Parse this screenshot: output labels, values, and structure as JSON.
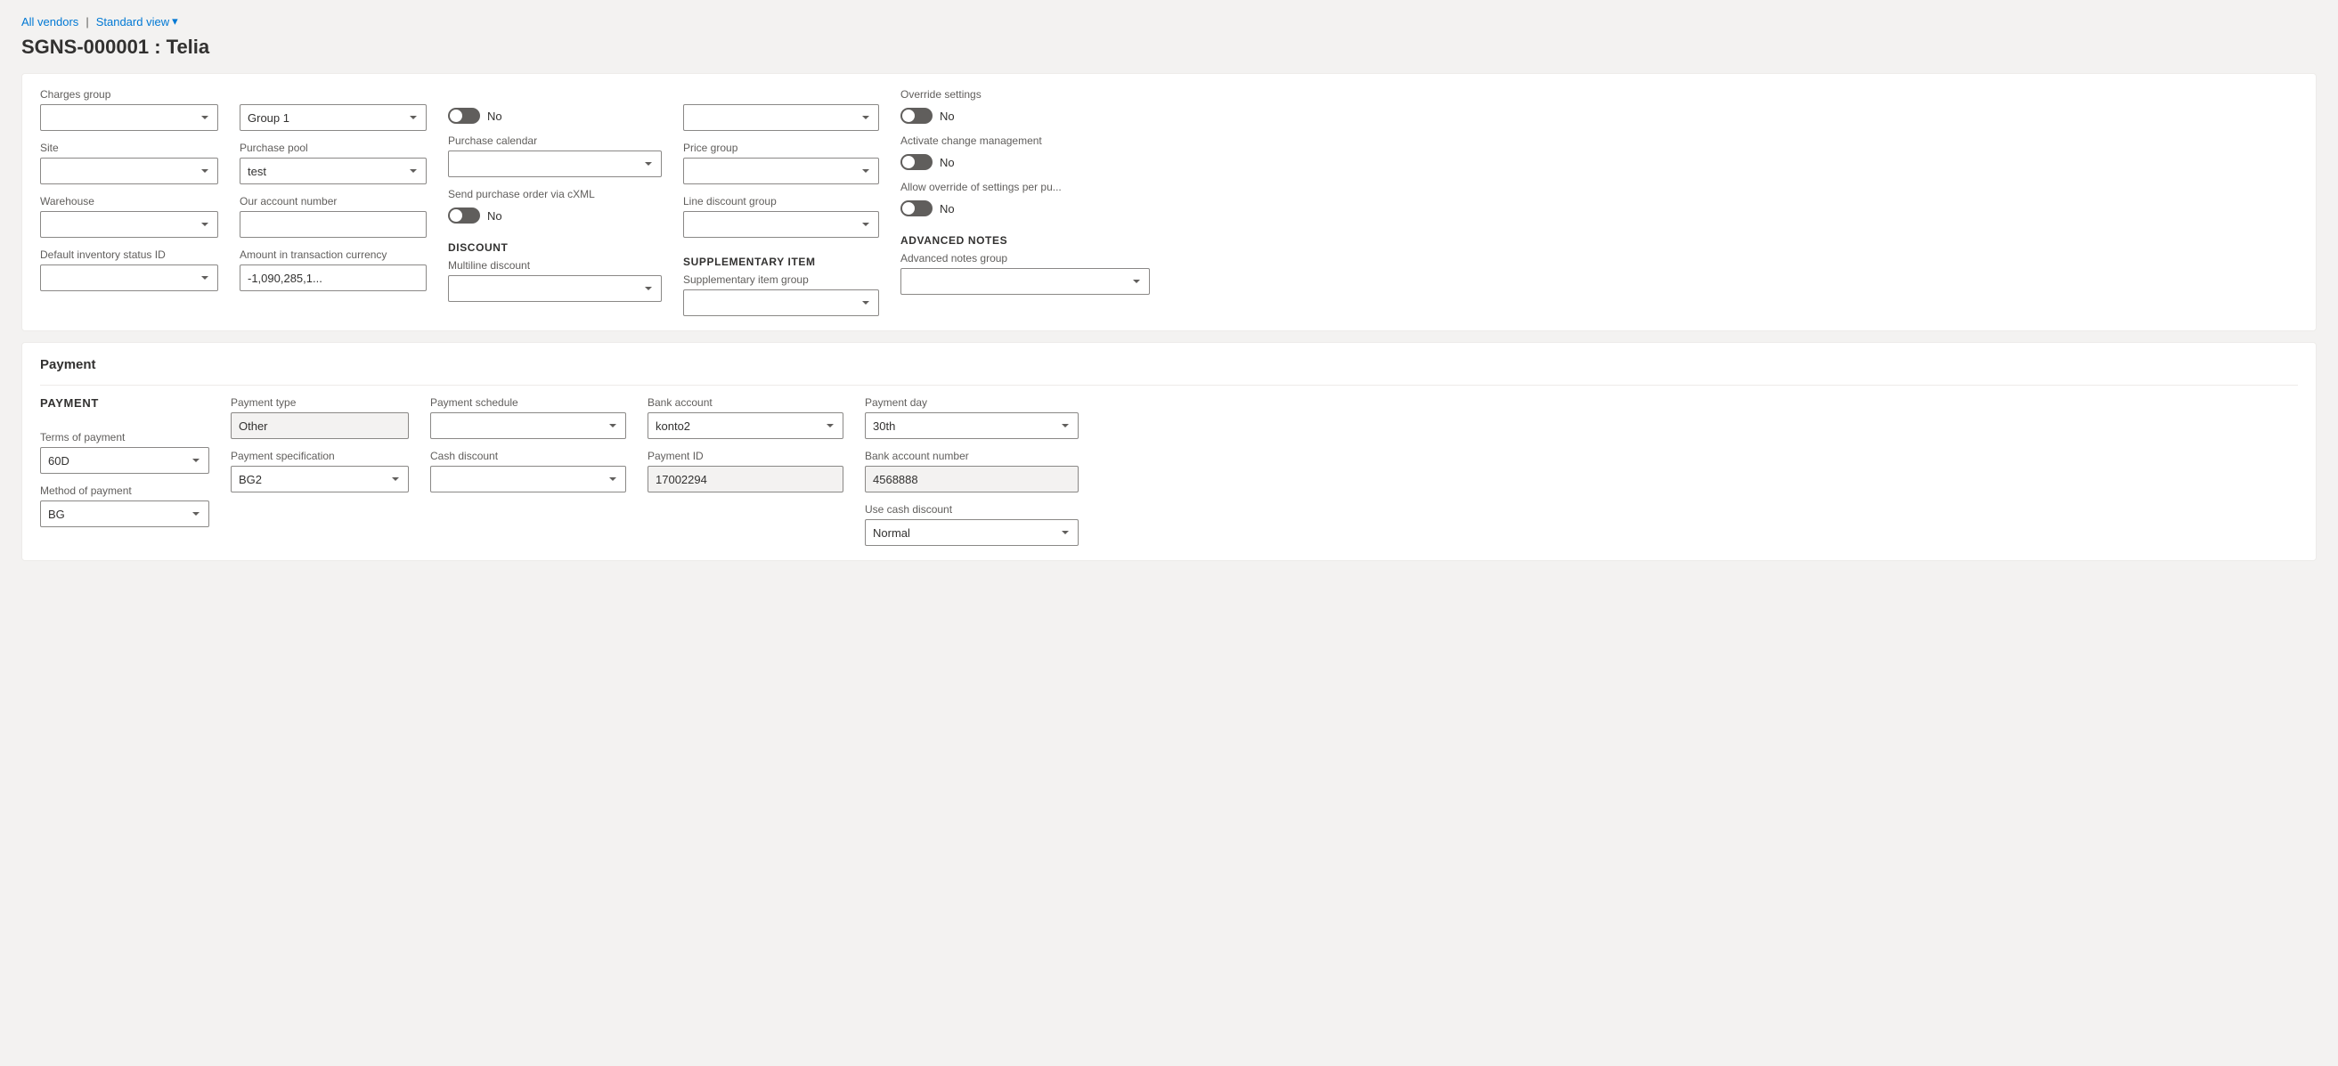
{
  "breadcrumb": {
    "all_vendors": "All vendors",
    "separator": "|",
    "view": "Standard view",
    "chevron": "▾"
  },
  "page_title": "SGNS-000001 : Telia",
  "purchase_section": {
    "charges_group": {
      "label": "Charges group",
      "value": ""
    },
    "purchase_pool": {
      "label": "Purchase pool",
      "value": "test"
    },
    "toggle1": {
      "value": "No",
      "state": "off"
    },
    "dropdown1": {
      "value": ""
    },
    "override_settings": {
      "label": "Override settings",
      "toggle_value": "No",
      "state": "off"
    },
    "site": {
      "label": "Site",
      "value": ""
    },
    "our_account_number": {
      "label": "Our account number",
      "value": ""
    },
    "purchase_calendar": {
      "label": "Purchase calendar",
      "value": ""
    },
    "price_group": {
      "label": "Price group",
      "value": ""
    },
    "activate_change_management": {
      "label": "Activate change management",
      "toggle_value": "No",
      "state": "off"
    },
    "warehouse": {
      "label": "Warehouse",
      "value": ""
    },
    "amount_in_transaction_currency": {
      "label": "Amount in transaction currency",
      "value": "-1,090,285,1..."
    },
    "send_purchase_order_via_cxml": {
      "label": "Send purchase order via cXML",
      "toggle_value": "No",
      "state": "off"
    },
    "line_discount_group": {
      "label": "Line discount group",
      "value": ""
    },
    "allow_override": {
      "label": "Allow override of settings per pu...",
      "toggle_value": "No",
      "state": "off"
    },
    "default_inventory_status_id": {
      "label": "Default inventory status ID",
      "value": ""
    },
    "discount_header": "DISCOUNT",
    "multiline_discount": {
      "label": "Multiline discount",
      "value": ""
    },
    "supplementary_item_header": "SUPPLEMENTARY ITEM",
    "supplementary_item_group": {
      "label": "Supplementary item group",
      "value": ""
    },
    "advanced_notes_header": "ADVANCED NOTES",
    "advanced_notes_group": {
      "label": "Advanced notes group",
      "value": ""
    },
    "group1_dropdown": "Group 1"
  },
  "payment_section": {
    "section_title": "Payment",
    "payment_header": "PAYMENT",
    "terms_of_payment": {
      "label": "Terms of payment",
      "value": "60D"
    },
    "payment_type": {
      "label": "Payment type",
      "value": "Other"
    },
    "payment_schedule": {
      "label": "Payment schedule",
      "value": ""
    },
    "bank_account": {
      "label": "Bank account",
      "value": "konto2"
    },
    "payment_day": {
      "label": "Payment day",
      "value": "30th"
    },
    "method_of_payment": {
      "label": "Method of payment",
      "value": "BG"
    },
    "payment_specification": {
      "label": "Payment specification",
      "value": "BG2"
    },
    "cash_discount": {
      "label": "Cash discount",
      "value": ""
    },
    "payment_id": {
      "label": "Payment ID",
      "value": "17002294"
    },
    "bank_account_number": {
      "label": "Bank account number",
      "value": "4568888"
    },
    "use_cash_discount": {
      "label": "Use cash discount",
      "value": "Normal"
    }
  }
}
